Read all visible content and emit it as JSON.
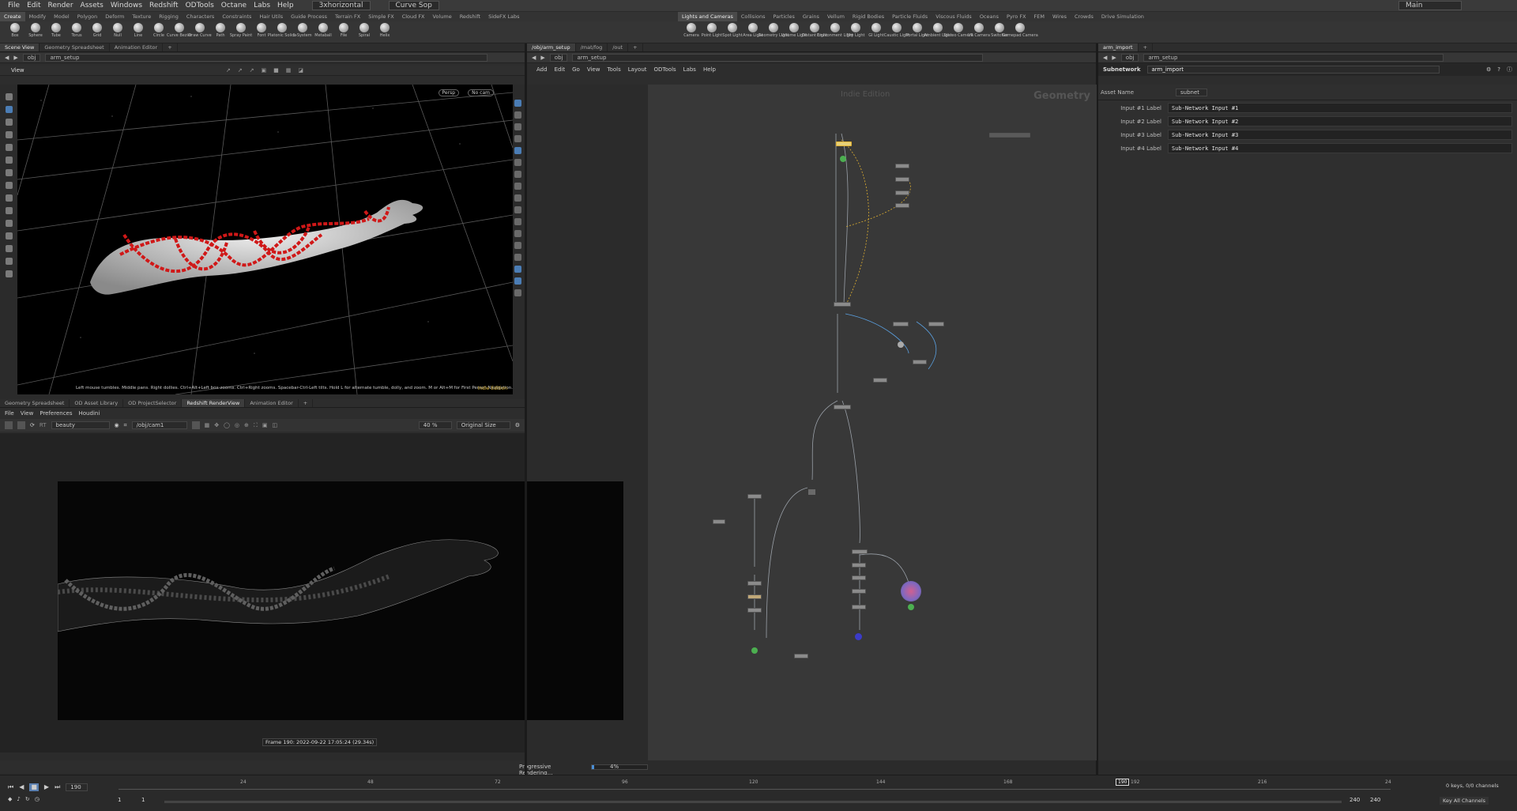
{
  "menubar": {
    "items": [
      "File",
      "Edit",
      "Render",
      "Assets",
      "Windows",
      "Redshift",
      "ODTools",
      "Octane",
      "Labs",
      "Help"
    ],
    "desktop": "3xhorizontal",
    "context": "Curve Sop",
    "right_label": "Main"
  },
  "shelf_tabs_left": [
    "Create",
    "Modify",
    "Model",
    "Polygon",
    "Deform",
    "Texture",
    "Rigging",
    "Characters",
    "Constraints",
    "Hair Utils",
    "Guide Process",
    "Terrain FX",
    "Simple FX",
    "Cloud FX",
    "Volume",
    "Redshift",
    "SideFX Labs"
  ],
  "shelf_tabs_right": [
    "Lights and Cameras",
    "Collisions",
    "Particles",
    "Grains",
    "Vellum",
    "Rigid Bodies",
    "Particle Fluids",
    "Viscous Fluids",
    "Oceans",
    "Pyro FX",
    "FEM",
    "Wires",
    "Crowds",
    "Drive Simulation"
  ],
  "tools_left": [
    "Box",
    "Sphere",
    "Tube",
    "Torus",
    "Grid",
    "Null",
    "Line",
    "Circle",
    "Curve Bezier",
    "Draw Curve",
    "Path",
    "Spray Paint",
    "Font",
    "Platonic Solids",
    "L-System",
    "Metaball",
    "File",
    "Spiral",
    "Helix"
  ],
  "tools_right": [
    "Camera",
    "Point Light",
    "Spot Light",
    "Area Light",
    "Geometry Light",
    "Volume Light",
    "Distant Light",
    "Environment Light",
    "Sky Light",
    "GI Light",
    "Caustic Light",
    "Portal Light",
    "Ambient Light",
    "Stereo Camera",
    "VR Camera",
    "Switcher",
    "Gamepad Camera"
  ],
  "viewport_pane": {
    "tabs": [
      "Scene View",
      "Geometry Spreadsheet",
      "Animation Editor"
    ],
    "path_root": "obj",
    "path_node": "arm_setup",
    "header": "View",
    "persp": "Persp",
    "cam": "No cam",
    "help_text": "Left mouse tumbles. Middle pans. Right dollies. Ctrl+Alt+Left box-zooms. Ctrl+Right zooms. Spacebar-Ctrl-Left tilts. Hold L for alternate tumble, dolly, and zoom.    M or Alt+M for First Person Navigation.",
    "edition": "Indie Edition"
  },
  "render_pane": {
    "tabs": [
      "Geometry Spreadsheet",
      "OD Asset Library",
      "OD ProjectSelector",
      "Redshift RenderView",
      "Animation Editor"
    ],
    "menu": [
      "File",
      "View",
      "Preferences",
      "Houdini"
    ],
    "aov": "beauty",
    "camera": "/obj/cam1",
    "zoom": "40 %",
    "size_mode": "Original Size",
    "frame_info": "Frame 190:  2022-09-22  17:05:24  (29.34s)",
    "progress_label": "Progressive Rendering...",
    "progress_pct": "4%",
    "progress": 0.04
  },
  "network_pane": {
    "tabs": [
      "/obj/arm_setup",
      "/mat/fog",
      "/out"
    ],
    "path_root": "obj",
    "path_node": "arm_setup",
    "menu": [
      "Add",
      "Edit",
      "Go",
      "View",
      "Tools",
      "Layout",
      "ODTools",
      "Labs",
      "Help"
    ],
    "watermark": "Indie Edition",
    "context_label": "Geometry"
  },
  "params_pane": {
    "tab": "arm_import",
    "path_root": "obj",
    "path_node": "arm_setup",
    "node_type": "Subnetwork",
    "node_name": "arm_import",
    "asset_name_label": "Asset Name",
    "asset_name_value": "subnet",
    "inputs": [
      {
        "label": "Input #1 Label",
        "value": "Sub-Network Input #1"
      },
      {
        "label": "Input #2 Label",
        "value": "Sub-Network Input #2"
      },
      {
        "label": "Input #3 Label",
        "value": "Sub-Network Input #3"
      },
      {
        "label": "Input #4 Label",
        "value": "Sub-Network Input #4"
      }
    ]
  },
  "timeline": {
    "current_frame": "190",
    "ticks": [
      "24",
      "48",
      "72",
      "96",
      "120",
      "144",
      "168",
      "192",
      "216",
      "24"
    ],
    "start_frame": "1",
    "start_frame2": "1",
    "end_frame": "240",
    "end_frame2": "240",
    "keys_info": "0 keys, 0/0 channels",
    "key_mode": "Key All Channels"
  },
  "colors": {
    "accent": "#f0c040",
    "viewport_bg": "#000000",
    "chain": "#d01818",
    "net_bg": "#383838"
  }
}
